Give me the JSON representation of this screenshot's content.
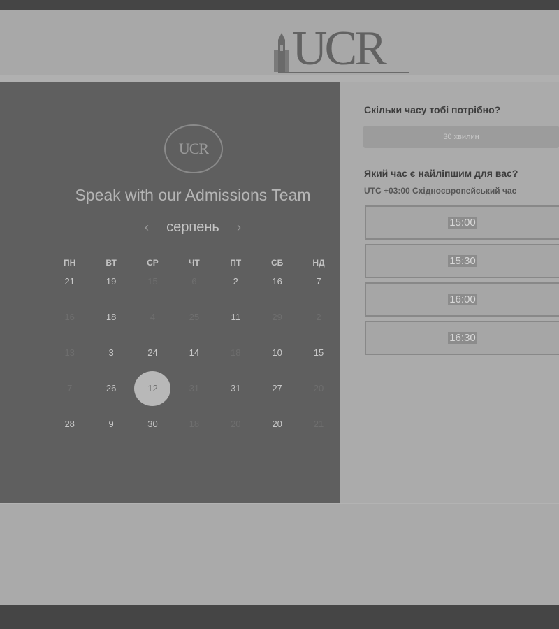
{
  "logo": {
    "letters": "UCR",
    "tagline": "University College Roosevelt"
  },
  "panel": {
    "circle_logo": "UCR",
    "title": "Speak with our Admissions Team",
    "month": "серпень",
    "prev_icon": "chevron-left-icon",
    "next_icon": "chevron-right-icon"
  },
  "calendar": {
    "weekdays": [
      "ПН",
      "ВТ",
      "СР",
      "ЧТ",
      "ПТ",
      "СБ",
      "НД"
    ],
    "weeks": [
      [
        {
          "d": "21",
          "dim": false
        },
        {
          "d": "19",
          "dim": false
        },
        {
          "d": "15",
          "dim": true
        },
        {
          "d": "6",
          "dim": true
        },
        {
          "d": "2",
          "dim": false
        },
        {
          "d": "16",
          "dim": false
        },
        {
          "d": "7",
          "dim": false
        }
      ],
      [
        {
          "d": "16",
          "dim": true
        },
        {
          "d": "18",
          "dim": false
        },
        {
          "d": "4",
          "dim": true
        },
        {
          "d": "25",
          "dim": true
        },
        {
          "d": "11",
          "dim": false
        },
        {
          "d": "29",
          "dim": true
        },
        {
          "d": "2",
          "dim": true
        }
      ],
      [
        {
          "d": "13",
          "dim": true
        },
        {
          "d": "3",
          "dim": false
        },
        {
          "d": "24",
          "dim": false
        },
        {
          "d": "14",
          "dim": false
        },
        {
          "d": "18",
          "dim": true
        },
        {
          "d": "10",
          "dim": false
        },
        {
          "d": "15",
          "dim": false
        }
      ],
      [
        {
          "d": "7",
          "dim": true
        },
        {
          "d": "26",
          "dim": false
        },
        {
          "d": "12",
          "dim": false,
          "selected": true
        },
        {
          "d": "31",
          "dim": true
        },
        {
          "d": "31",
          "dim": false
        },
        {
          "d": "27",
          "dim": false
        },
        {
          "d": "20",
          "dim": true
        }
      ],
      [
        {
          "d": "28",
          "dim": false
        },
        {
          "d": "9",
          "dim": false
        },
        {
          "d": "30",
          "dim": false
        },
        {
          "d": "18",
          "dim": true
        },
        {
          "d": "20",
          "dim": true
        },
        {
          "d": "20",
          "dim": false
        },
        {
          "d": "21",
          "dim": true
        }
      ]
    ]
  },
  "booking": {
    "duration_question": "Скільки часу тобі потрібно?",
    "duration_value": "30 хвилин",
    "time_question": "Який час є найліпшим для вас?",
    "timezone": "UTC +03:00 Східноєвропейський час",
    "slots": [
      "15:00",
      "15:30",
      "16:00",
      "16:30"
    ]
  }
}
